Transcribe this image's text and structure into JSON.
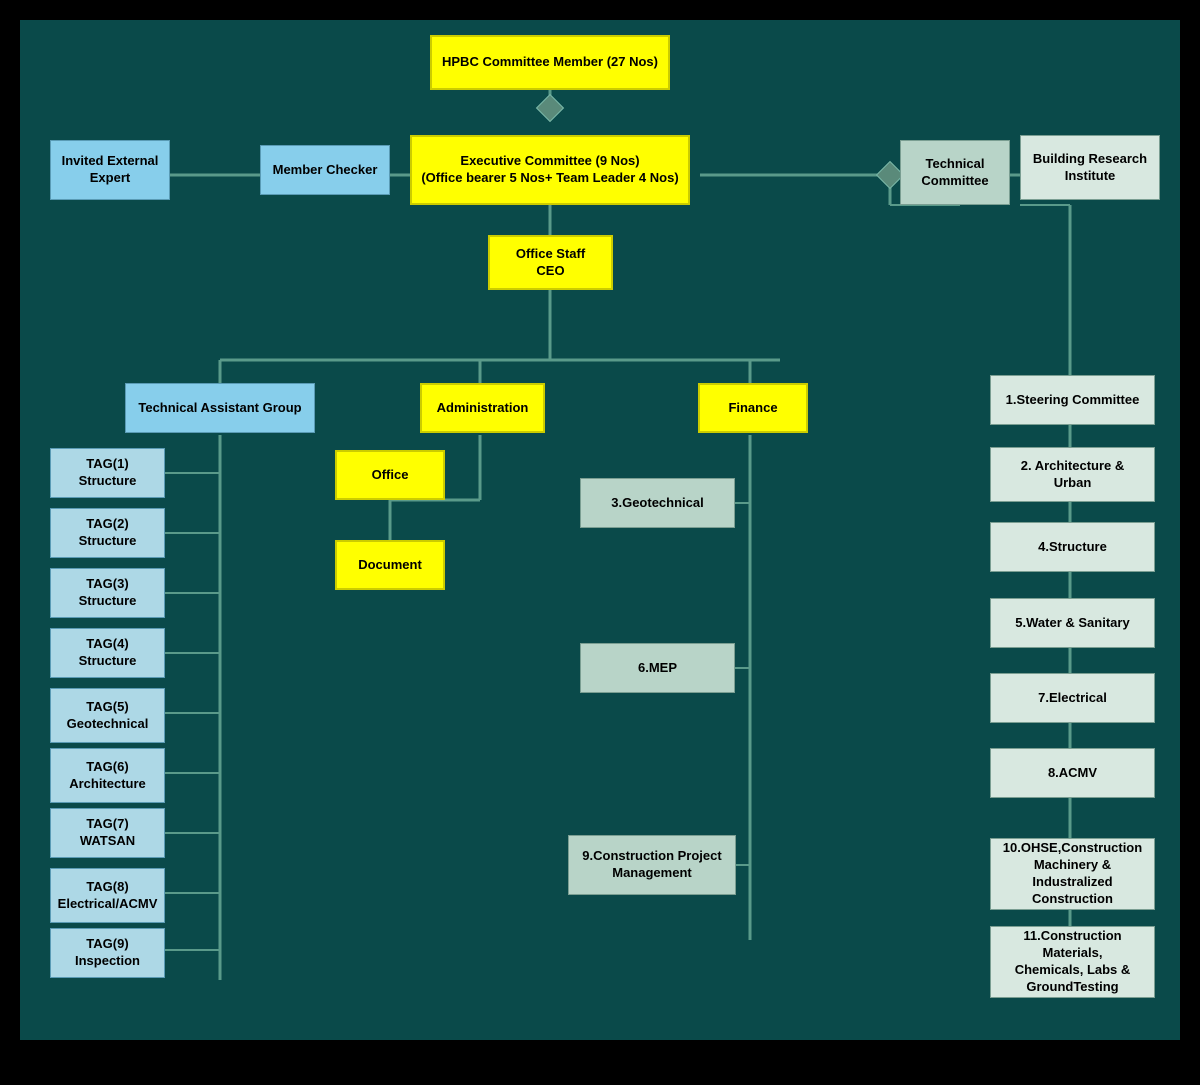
{
  "boxes": {
    "hpbc": {
      "label": "HPBC Committee Member (27 Nos)"
    },
    "executive": {
      "label": "Executive Committee (9 Nos)\n(Office bearer 5 Nos+ Team Leader 4 Nos)"
    },
    "invited_expert": {
      "label": "Invited External\nExpert"
    },
    "member_checker": {
      "label": "Member Checker"
    },
    "technical_committee": {
      "label": "Technical\nCommittee"
    },
    "building_research": {
      "label": "Building Research\nInstitute"
    },
    "office_staff": {
      "label": "Office Staff\nCEO"
    },
    "tech_assistant": {
      "label": "Technical Assistant Group"
    },
    "administration": {
      "label": "Administration"
    },
    "finance": {
      "label": "Finance"
    },
    "office": {
      "label": "Office"
    },
    "document": {
      "label": "Document"
    },
    "tag1": {
      "label": "TAG(1)\nStructure"
    },
    "tag2": {
      "label": "TAG(2)\nStructure"
    },
    "tag3": {
      "label": "TAG(3)\nStructure"
    },
    "tag4": {
      "label": "TAG(4)\nStructure"
    },
    "tag5": {
      "label": "TAG(5)\nGeotechnical"
    },
    "tag6": {
      "label": "TAG(6)\nArchitecture"
    },
    "tag7": {
      "label": "TAG(7)\nWATSAN"
    },
    "tag8": {
      "label": "TAG(8)\nElectrical/ACMV"
    },
    "tag9": {
      "label": "TAG(9)\nInspection"
    },
    "geotechnical": {
      "label": "3.Geotechnical"
    },
    "mep": {
      "label": "6.MEP"
    },
    "construction_pm": {
      "label": "9.Construction Project\nManagement"
    },
    "steering": {
      "label": "1.Steering Committee"
    },
    "architecture_urban": {
      "label": "2. Architecture &\nUrban"
    },
    "structure": {
      "label": "4.Structure"
    },
    "water_sanitary": {
      "label": "5.Water & Sanitary"
    },
    "electrical": {
      "label": "7.Electrical"
    },
    "acmv": {
      "label": "8.ACMV"
    },
    "ohse": {
      "label": "10.OHSE,Construction\nMachinery & Industralized\nConstruction"
    },
    "construction_materials": {
      "label": "11.Construction Materials,\nChemicals, Labs &\nGroundTesting"
    }
  }
}
